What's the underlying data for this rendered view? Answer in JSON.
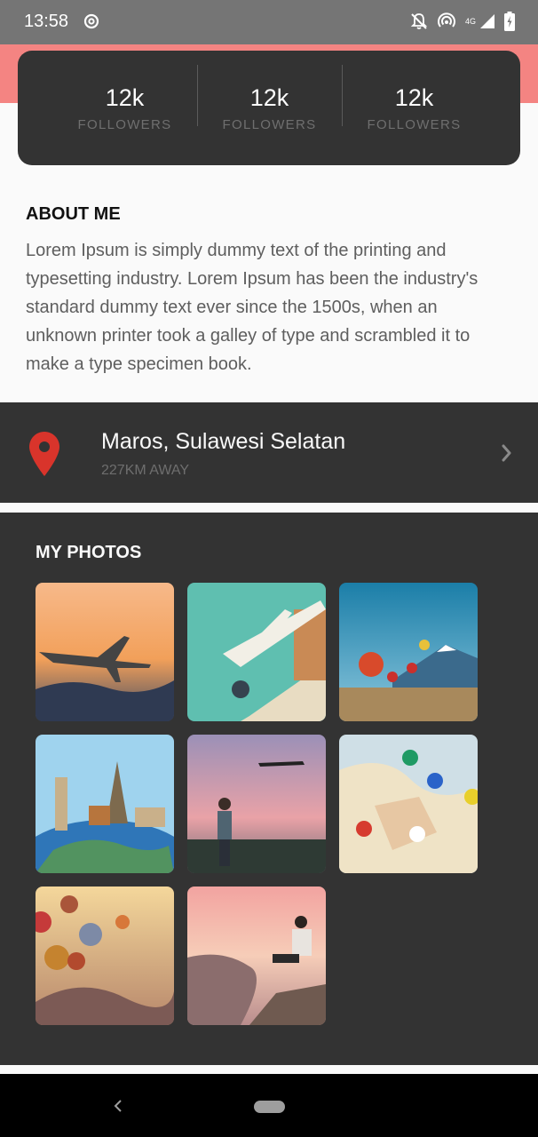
{
  "status_bar": {
    "time": "13:58",
    "network_label": "4G",
    "icons": [
      "sync-icon",
      "notifications-off-icon",
      "hotspot-icon",
      "signal-icon",
      "battery-icon"
    ]
  },
  "colors": {
    "accent": "#f48482",
    "card": "#333333",
    "background": "#fafafa",
    "pin": "#d9342b"
  },
  "stats": [
    {
      "value": "12k",
      "label": "FOLLOWERS"
    },
    {
      "value": "12k",
      "label": "FOLLOWERS"
    },
    {
      "value": "12k",
      "label": "FOLLOWERS"
    }
  ],
  "about": {
    "title": "ABOUT ME",
    "text": "Lorem Ipsum is simply dummy text of the printing and typesetting industry. Lorem Ipsum has been the industry's standard dummy text ever since the 1500s, when an unknown printer took a galley of type and scrambled it to make a type specimen book."
  },
  "location": {
    "name": "Maros, Sulawesi Selatan",
    "distance": "227KM AWAY"
  },
  "photos": {
    "title": "MY PHOTOS",
    "items": [
      {
        "subject": "airplane-sunset"
      },
      {
        "subject": "airplane-illustration"
      },
      {
        "subject": "balloons-mountain"
      },
      {
        "subject": "world-landmarks"
      },
      {
        "subject": "traveler-airplane"
      },
      {
        "subject": "map-pins"
      },
      {
        "subject": "hot-air-balloons"
      },
      {
        "subject": "hiker-cliff"
      }
    ]
  }
}
